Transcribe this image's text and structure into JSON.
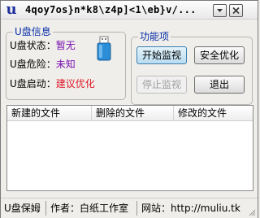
{
  "window": {
    "title": "4qoy7os}n*k8\\z4p]<1\\eb}v/...",
    "app_icon_glyph": "u"
  },
  "info_group": {
    "title": "U盘信息",
    "rows": [
      {
        "label": "U盘状态：",
        "value": "暂无"
      },
      {
        "label": "U盘危险：",
        "value": "未知"
      },
      {
        "label": "U盘启动：",
        "value": "建议优化"
      }
    ]
  },
  "func_group": {
    "title": "功能项",
    "buttons": {
      "start_monitor": "开始监视",
      "safe_optimize": "安全优化",
      "stop_monitor": "停止监视",
      "exit": "退出"
    }
  },
  "file_list": {
    "columns": [
      "新建的文件",
      "删除的文件",
      "修改的文件"
    ],
    "rows": []
  },
  "status_bar": {
    "app_name": "U盘保姆",
    "author": "作者：白纸工作室",
    "website": "网站：http://muliu.tk"
  },
  "colors": {
    "group_title": "#0a2fa8",
    "value_purple": "#7a0fb0",
    "value_red": "#e0182a",
    "usb_blue": "#2b8ed6"
  }
}
